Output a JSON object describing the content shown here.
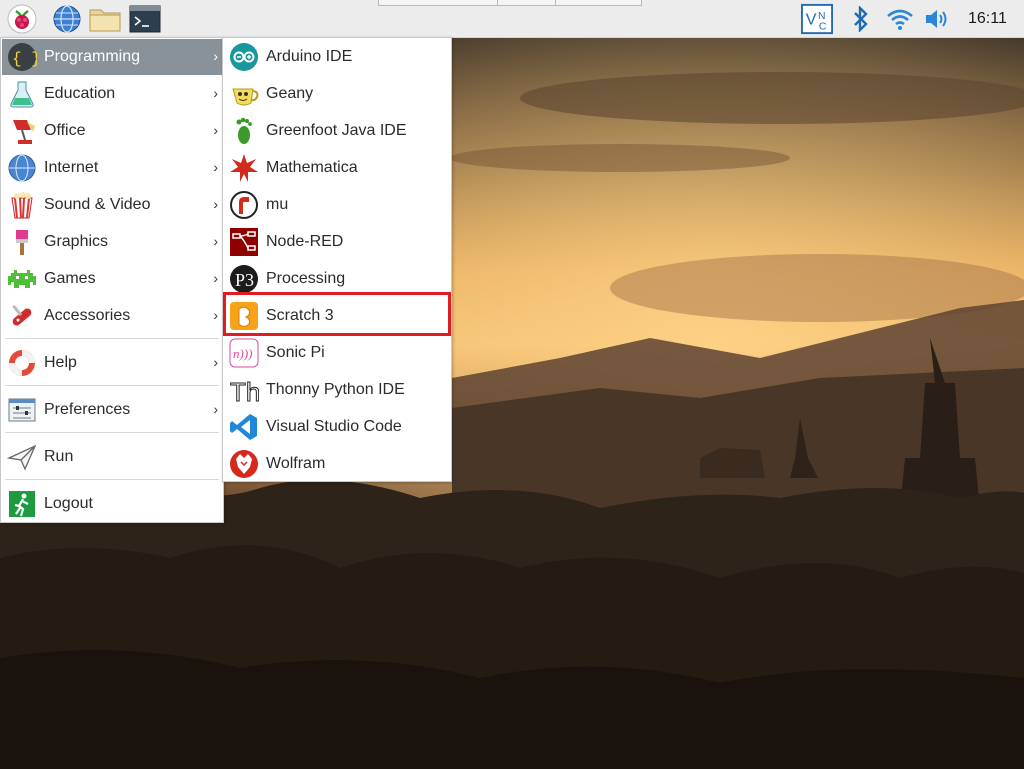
{
  "taskbar": {
    "launchers": [
      {
        "icon": "raspberry-pi-menu-icon"
      },
      {
        "icon": "globe-browser-icon"
      },
      {
        "icon": "folder-icon"
      },
      {
        "icon": "terminal-icon"
      }
    ],
    "tray": [
      {
        "icon": "vnc-icon"
      },
      {
        "icon": "bluetooth-icon"
      },
      {
        "icon": "wifi-icon"
      },
      {
        "icon": "volume-icon"
      }
    ],
    "clock": "16:11"
  },
  "main_menu": {
    "items": [
      {
        "label": "Programming",
        "icon": "programming-icon",
        "submenu": true,
        "active": true
      },
      {
        "label": "Education",
        "icon": "education-icon",
        "submenu": true
      },
      {
        "label": "Office",
        "icon": "office-icon",
        "submenu": true
      },
      {
        "label": "Internet",
        "icon": "internet-icon",
        "submenu": true
      },
      {
        "label": "Sound & Video",
        "icon": "sound-video-icon",
        "submenu": true
      },
      {
        "label": "Graphics",
        "icon": "graphics-icon",
        "submenu": true
      },
      {
        "label": "Games",
        "icon": "games-icon",
        "submenu": true
      },
      {
        "label": "Accessories",
        "icon": "accessories-icon",
        "submenu": true
      },
      {
        "label": "Help",
        "icon": "help-icon",
        "submenu": true
      },
      {
        "label": "Preferences",
        "icon": "preferences-icon",
        "submenu": true
      },
      {
        "label": "Run",
        "icon": "run-icon",
        "submenu": false
      },
      {
        "label": "Logout",
        "icon": "logout-icon",
        "submenu": false
      }
    ],
    "arrow_glyph": "›"
  },
  "programming_submenu": {
    "items": [
      {
        "label": "Arduino IDE",
        "icon": "arduino-icon"
      },
      {
        "label": "Geany",
        "icon": "geany-icon"
      },
      {
        "label": "Greenfoot Java IDE",
        "icon": "greenfoot-icon"
      },
      {
        "label": "Mathematica",
        "icon": "mathematica-icon"
      },
      {
        "label": "mu",
        "icon": "mu-icon"
      },
      {
        "label": "Node-RED",
        "icon": "node-red-icon"
      },
      {
        "label": "Processing",
        "icon": "processing-icon"
      },
      {
        "label": "Scratch 3",
        "icon": "scratch-icon",
        "highlighted": true
      },
      {
        "label": "Sonic Pi",
        "icon": "sonic-pi-icon"
      },
      {
        "label": "Thonny Python IDE",
        "icon": "thonny-icon"
      },
      {
        "label": "Visual Studio Code",
        "icon": "vscode-icon"
      },
      {
        "label": "Wolfram",
        "icon": "wolfram-icon"
      }
    ]
  },
  "colors": {
    "active_item": "#8a9299",
    "highlight_border": "#e01b22",
    "panel": "#ececec"
  }
}
